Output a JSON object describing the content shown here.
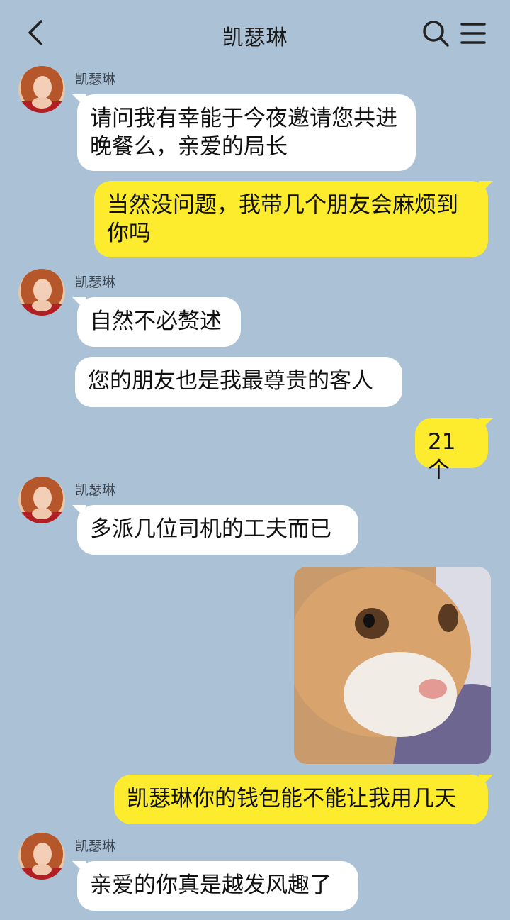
{
  "header": {
    "title": "凯瑟琳",
    "back_icon": "chevron-left-icon",
    "search_icon": "search-icon",
    "menu_icon": "menu-icon"
  },
  "messages": [
    {
      "from": "them",
      "sender": "凯瑟琳",
      "text": "请问我有幸能于今夜邀请您共进晚餐么，亲爱的局长"
    },
    {
      "from": "me",
      "text": "当然没问题，我带几个朋友会麻烦到你吗"
    },
    {
      "from": "them",
      "sender": "凯瑟琳",
      "text": "自然不必赘述"
    },
    {
      "from": "them",
      "text": "您的朋友也是我最尊贵的客人"
    },
    {
      "from": "me",
      "text": "21个"
    },
    {
      "from": "them",
      "sender": "凯瑟琳",
      "text": "多派几位司机的工夫而已"
    },
    {
      "from": "me",
      "type": "image",
      "image": "cat-photo"
    },
    {
      "from": "me",
      "text": "凯瑟琳你的钱包能不能让我用几天"
    },
    {
      "from": "them",
      "sender": "凯瑟琳",
      "text": "亲爱的你真是越发风趣了"
    }
  ],
  "colors": {
    "background": "#abc1d6",
    "incoming_bubble": "#ffffff",
    "outgoing_bubble": "#fdeb2d"
  }
}
